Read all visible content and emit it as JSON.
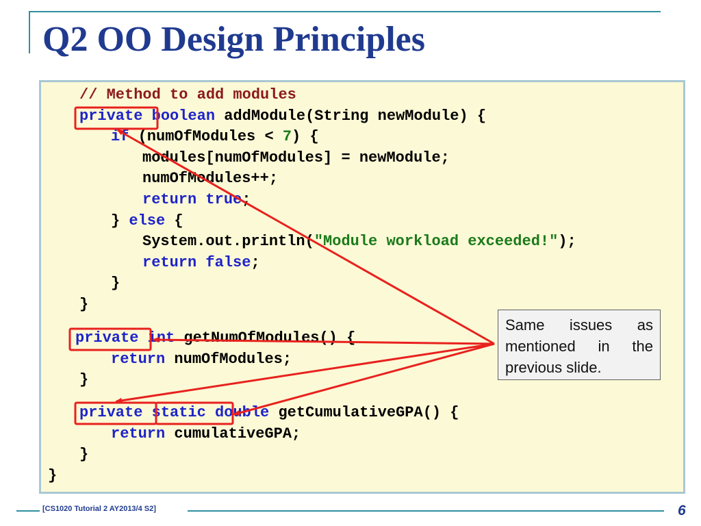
{
  "slide": {
    "title": "Q2 OO Design Principles",
    "footer": "[CS1020 Tutorial 2 AY2013/4 S2]",
    "page_number": "6"
  },
  "code": {
    "line1": "// Method to add modules",
    "line2": {
      "kw1": "private",
      "kw2": "boolean",
      "rest": " addModule(String newModule) {"
    },
    "line3": {
      "kw": "if",
      "rest_a": " (numOfModules < ",
      "num": "7",
      "rest_b": ") {"
    },
    "line4": "modules[numOfModules] = newModule;",
    "line5": "numOfModules++;",
    "line6": {
      "kw1": "return",
      "kw2": "true",
      "rest": ";"
    },
    "line7": {
      "open": "} ",
      "kw": "else",
      "rest": " {"
    },
    "line8": {
      "pre": "System.out.println(",
      "str": "\"Module workload exceeded!\"",
      "post": ");"
    },
    "line9": {
      "kw1": "return",
      "kw2": "false",
      "rest": ";"
    },
    "line10": "}",
    "line11": "}",
    "line12": {
      "kw1": "private",
      "kw2": "int",
      "rest": " getNumOfModules() {"
    },
    "line13": {
      "kw": "return",
      "rest": " numOfModules;"
    },
    "line14": "}",
    "line15": {
      "kw1": "private",
      "kw2": "static",
      "kw3": "double",
      "rest": " getCumulativeGPA() {"
    },
    "line16": {
      "kw": "return",
      "rest": " cumulativeGPA;"
    },
    "line17": "}",
    "line18": "}"
  },
  "callout": {
    "text": "Same issues as mentioned in the previous slide."
  },
  "colors": {
    "title": "#1f3a8f",
    "keyword": "#1d23c9",
    "comment": "#8b1a1a",
    "string": "#1a7a1a",
    "code_background": "#fcf9d6",
    "annotation": "#e8211e"
  }
}
